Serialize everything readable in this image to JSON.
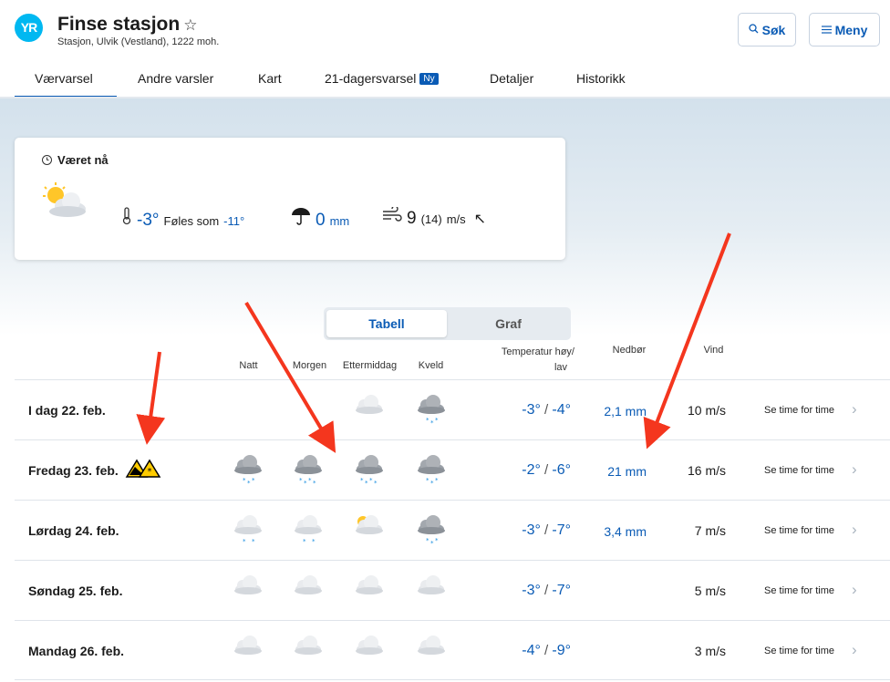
{
  "header": {
    "logo_text": "YR",
    "title": "Finse stasjon",
    "star": "☆",
    "subtitle": "Stasjon, Ulvik (Vestland), 1222 moh.",
    "search_label": "Søk",
    "menu_label": "Meny"
  },
  "tabs": [
    {
      "label": "Værvarsel",
      "active": true
    },
    {
      "label": "Andre varsler"
    },
    {
      "label": "Kart"
    },
    {
      "label": "21-dagersvarsel",
      "badge": "Ny"
    },
    {
      "label": "Detaljer"
    },
    {
      "label": "Historikk"
    }
  ],
  "now": {
    "title": "Været nå",
    "temp": "-3°",
    "feels_label": "Føles som",
    "feels": "-11°",
    "precip": "0",
    "precip_unit": "mm",
    "wind": "9",
    "gust": "(14)",
    "wind_unit": "m/s",
    "wind_arrow": "↖"
  },
  "view_toggle": {
    "table": "Tabell",
    "graph": "Graf"
  },
  "columns": {
    "night": "Natt",
    "morning": "Morgen",
    "afternoon": "Ettermiddag",
    "evening": "Kveld",
    "temp_line1": "Temperatur høy/",
    "temp_line2": "lav",
    "precip": "Nedbør",
    "wind": "Vind"
  },
  "rows": [
    {
      "date": "I dag 22. feb.",
      "high": "-3°",
      "low": "-4°",
      "precip": "2,1 mm",
      "wind": "10 m/s",
      "link": "Se time for time",
      "icons": [
        "",
        "",
        "cloud",
        "snow-cloud"
      ]
    },
    {
      "date": "Fredag 23. feb.",
      "high": "-2°",
      "low": "-6°",
      "precip": "21 mm",
      "wind": "16 m/s",
      "link": "Se time for time",
      "warning": true,
      "icons": [
        "snow-cloud",
        "heavy-snow-cloud",
        "heavy-snow-cloud",
        "snow-cloud"
      ]
    },
    {
      "date": "Lørdag 24. feb.",
      "high": "-3°",
      "low": "-7°",
      "precip": "3,4 mm",
      "wind": "7 m/s",
      "link": "Se time for time",
      "icons": [
        "light-snow-cloud",
        "light-snow-cloud",
        "partly-sunny",
        "snow-cloud"
      ]
    },
    {
      "date": "Søndag 25. feb.",
      "high": "-3°",
      "low": "-7°",
      "precip": "",
      "wind": "5 m/s",
      "link": "Se time for time",
      "icons": [
        "cloud",
        "cloud",
        "cloud",
        "cloud"
      ]
    },
    {
      "date": "Mandag 26. feb.",
      "high": "-4°",
      "low": "-9°",
      "precip": "",
      "wind": "3 m/s",
      "link": "Se time for time",
      "icons": [
        "cloud",
        "cloud",
        "cloud",
        "cloud"
      ]
    }
  ],
  "colors": {
    "accent": "#0a5bb5",
    "logo": "#00b8f1",
    "annotation": "#f4361e"
  }
}
